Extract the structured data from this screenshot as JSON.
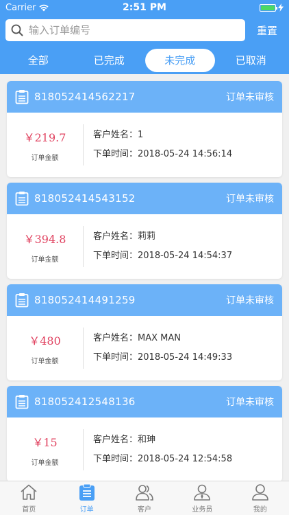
{
  "status_bar": {
    "carrier": "Carrier",
    "time": "2:51 PM"
  },
  "search": {
    "placeholder": "输入订单编号",
    "reset_label": "重置"
  },
  "tabs": [
    {
      "label": "全部",
      "active": false
    },
    {
      "label": "已完成",
      "active": false
    },
    {
      "label": "未完成",
      "active": true
    },
    {
      "label": "已取消",
      "active": false
    }
  ],
  "orders": [
    {
      "order_no": "818052414562217",
      "state": "订单未审核",
      "amount": "￥219.7",
      "amount_label": "订单金额",
      "customer_label": "客户姓名：",
      "customer": "1",
      "time_label": "下单时间：",
      "time": "2018-05-24 14:56:14"
    },
    {
      "order_no": "818052414543152",
      "state": "订单未审核",
      "amount": "￥394.8",
      "amount_label": "订单金额",
      "customer_label": "客户姓名：",
      "customer": "莉莉",
      "time_label": "下单时间：",
      "time": "2018-05-24 14:54:37"
    },
    {
      "order_no": "818052414491259",
      "state": "订单未审核",
      "amount": "￥480",
      "amount_label": "订单金额",
      "customer_label": "客户姓名：",
      "customer": "MAX MAN",
      "time_label": "下单时间：",
      "time": "2018-05-24 14:49:33"
    },
    {
      "order_no": "818052412548136",
      "state": "订单未审核",
      "amount": "￥15",
      "amount_label": "订单金额",
      "customer_label": "客户姓名：",
      "customer": "和珅",
      "time_label": "下单时间：",
      "time": "2018-05-24 12:54:58"
    }
  ],
  "tabbar": [
    {
      "label": "首页",
      "icon": "home-icon",
      "active": false
    },
    {
      "label": "订单",
      "icon": "order-icon",
      "active": true
    },
    {
      "label": "客户",
      "icon": "customers-icon",
      "active": false
    },
    {
      "label": "业务员",
      "icon": "salesman-icon",
      "active": false
    },
    {
      "label": "我的",
      "icon": "profile-icon",
      "active": false
    }
  ],
  "colors": {
    "primary": "#4a9ff5",
    "card_header": "#6cb2f8",
    "amount": "#e0405e",
    "battery": "#4cd964"
  }
}
